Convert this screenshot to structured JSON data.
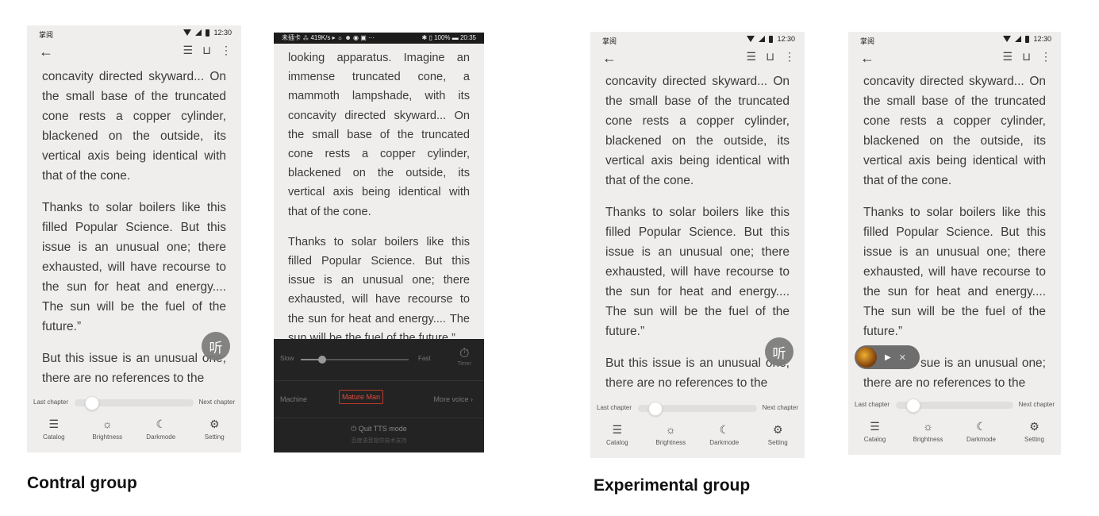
{
  "screen": {
    "app_name": "掌阅",
    "time": "12:30",
    "paragraph1": "concavity directed skyward... On the small base of the truncated cone rests a copper cylinder, blackened on the outside, its vertical axis being identical with that of the cone.",
    "paragraph2": "Thanks to solar boilers like this filled Popular Science. But this issue is an unusual one; there exhausted, will have recourse to the sun for heat and energy.... The sun will be the fuel of the future.”",
    "paragraph3": "But this issue is an unusual one; there are no references to the",
    "listen_label": "听",
    "last_chapter": "Last chapter",
    "next_chapter": "Next chapter",
    "nav": {
      "catalog": "Catalog",
      "brightness": "Brightness",
      "darkmode": "Darkmode",
      "setting": "Setting"
    },
    "chapter_progress": 0.1
  },
  "screen2": {
    "status_left": "未插卡 ⁂ 419K/s ▸ ☼ ☻ ◉ ▣ ···",
    "status_right": "✱ ▯ 100% ▬ 20:35",
    "paragraph1": "looking apparatus. Imagine an immense truncated cone, a mammoth lampshade, with its concavity directed skyward... On the small base of the truncated cone rests a copper cylinder, blackened on the outside, its vertical axis being identical with that of the cone.",
    "paragraph2": "Thanks to solar boilers like this filled Popular Science. But this issue is an unusual one; there exhausted, will have recourse to the sun for heat and energy.... The sun will be the fuel of the future.”",
    "tts": {
      "slow": "Slow",
      "fast": "Fast",
      "timer": "Timer",
      "speed": 0.2,
      "machine": "Machine",
      "selected_voice": "Mature Man",
      "more_voice": "More voice",
      "quit": "Quit TTS mode",
      "quit_sub": "百度语音提供技术支持"
    }
  },
  "screen4": {
    "paragraph3_partial": "sue is an unusual one; there are no references to the"
  },
  "captions": {
    "control": "Contral group",
    "experimental": "Experimental group"
  },
  "colors": {
    "page_bg": "#efeeec",
    "tts_panel": "#232323",
    "voice_accent": "#e04b3b"
  }
}
